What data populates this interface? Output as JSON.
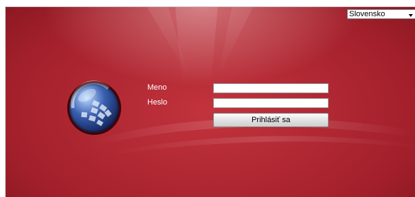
{
  "language": {
    "selected": "Slovensko"
  },
  "login": {
    "username_label": "Meno",
    "password_label": "Heslo",
    "username_value": "",
    "password_value": "",
    "submit_label": "Prihlásiť sa"
  },
  "colors": {
    "background_red": "#a3202b",
    "background_dark": "#6e0d16",
    "highlight": "#c2333d",
    "label_text": "#ffffff"
  },
  "icons": {
    "logo": "globe-logo-icon",
    "dropdown": "chevron-down-icon"
  }
}
